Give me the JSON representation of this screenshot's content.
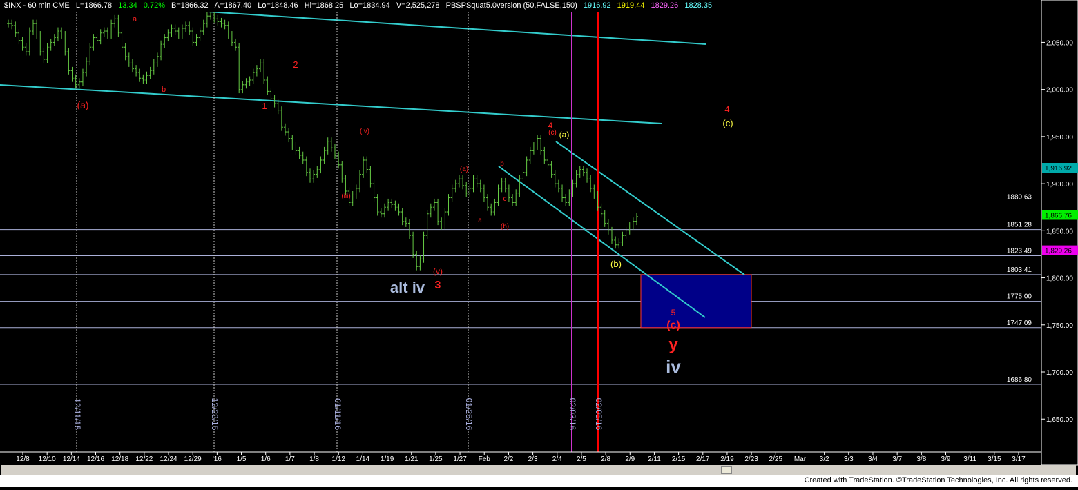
{
  "header": {
    "symbol": "$INX - 60 min  CME",
    "last": "L=1866.78",
    "change": "13.34",
    "change_pct": "0.72%",
    "bid": "B=1866.32",
    "ask": "A=1867.40",
    "low_today": "Lo=1848.46",
    "high": "Hi=1868.25",
    "low": "Lo=1834.94",
    "volume": "V=2,525,278",
    "indicator": "PBSPSquat5.0version (50,FALSE,150)",
    "ind_v1": "1916.92",
    "ind_v2": "1919.44",
    "ind_v3": "1829.26",
    "ind_v4": "1828.35"
  },
  "footer": {
    "text": "Created with TradeStation. ©TradeStation Technologies, Inc. All rights reserved."
  },
  "colors": {
    "background": "#000000",
    "bars": "#66cc44",
    "channel": "#33cccc",
    "red_label": "#ff2222",
    "yellow_label": "#ffff44",
    "blue_label": "#aabbdd",
    "target_box": "#000088",
    "magenta_line": "#cc33cc"
  },
  "chart_data": {
    "type": "ohlc",
    "ylim": [
      1615,
      2095
    ],
    "y_ticks": [
      "1,650.00",
      "1,700.00",
      "1,750.00",
      "1,800.00",
      "1,850.00",
      "1,900.00",
      "1,950.00",
      "2,000.00",
      "2,050.00"
    ],
    "x_labels": [
      "12/8",
      "12/10",
      "12/14",
      "12/16",
      "12/18",
      "12/22",
      "12/24",
      "12/29",
      "'16",
      "1/5",
      "1/6",
      "1/7",
      "1/8",
      "1/12",
      "1/14",
      "1/19",
      "1/21",
      "1/25",
      "1/27",
      "Feb",
      "2/2",
      "2/3",
      "2/4",
      "2/5",
      "2/8",
      "2/9",
      "2/11",
      "2/15",
      "2/17",
      "2/19",
      "2/23",
      "2/25",
      "Mar",
      "3/2",
      "3/3",
      "3/4",
      "3/7",
      "3/8",
      "3/9",
      "3/11",
      "3/15",
      "3/17"
    ],
    "price_levels": [
      "1880.63",
      "1851.28",
      "1823.49",
      "1803.41",
      "1775.00",
      "1747.09",
      "1686.80"
    ],
    "price_tags": [
      {
        "value": "1,916.92",
        "color": "#00aaaa"
      },
      {
        "value": "1,866.76",
        "color": "#00ee00"
      },
      {
        "value": "1,829.26",
        "color": "#ee00ee"
      }
    ],
    "date_markers": [
      "12/11/15",
      "12/28/15",
      "01/11/16",
      "01/25/16",
      "02/03/16",
      "02/05/16"
    ],
    "wave_labels": {
      "red": [
        "(a)",
        "a",
        "b",
        "1",
        "2",
        "(iii)",
        "(iv)",
        "(v)",
        "3",
        "(a)",
        "a",
        "b",
        "c",
        "(b)",
        "4",
        "(c)",
        "5",
        "(c)",
        "y",
        "4"
      ],
      "yellow": [
        "(a)",
        "(b)",
        "(c)"
      ],
      "blue": [
        "alt iv",
        "iv"
      ]
    },
    "target_zone": [
      1747.09,
      1803.41
    ],
    "series": [
      {
        "values": [
          2070,
          2068,
          2060,
          2052,
          2045,
          2040,
          2062,
          2070,
          2058,
          2040,
          2032,
          2045,
          2050,
          2055,
          2062,
          2058,
          2040,
          2020,
          2012,
          2005,
          2008,
          2018,
          2030,
          2045,
          2055,
          2052,
          2060,
          2062,
          2058,
          2070,
          2075,
          2060,
          2045,
          2035,
          2028,
          2022,
          2018,
          2012,
          2010,
          2015,
          2020,
          2028,
          2035,
          2048,
          2055,
          2060,
          2065,
          2062,
          2058,
          2065,
          2068,
          2062,
          2050,
          2055,
          2062,
          2070,
          2078,
          2080,
          2075,
          2072,
          2070,
          2068,
          2058,
          2050,
          2045,
          2000,
          2005,
          2008,
          2010,
          2018,
          2022,
          2028,
          2010,
          1998,
          1990,
          1985,
          1978,
          1960,
          1955,
          1948,
          1940,
          1935,
          1930,
          1925,
          1912,
          1905,
          1910,
          1915,
          1925,
          1935,
          1945,
          1938,
          1930,
          1920,
          1905,
          1892,
          1880,
          1888,
          1895,
          1910,
          1925,
          1915,
          1900,
          1885,
          1870,
          1868,
          1875,
          1880,
          1878,
          1875,
          1870,
          1860,
          1858,
          1845,
          1825,
          1812,
          1820,
          1845,
          1868,
          1875,
          1880,
          1860,
          1855,
          1870,
          1885,
          1895,
          1900,
          1905,
          1898,
          1890,
          1895,
          1905,
          1900,
          1895,
          1885,
          1875,
          1870,
          1880,
          1895,
          1902,
          1895,
          1885,
          1880,
          1890,
          1905,
          1912,
          1925,
          1935,
          1940,
          1948,
          1935,
          1925,
          1920,
          1910,
          1900,
          1895,
          1885,
          1880,
          1890,
          1900,
          1910,
          1915,
          1912,
          1905,
          1895,
          1888,
          1875,
          1868,
          1858,
          1850,
          1840,
          1835,
          1838,
          1845,
          1850,
          1855,
          1860,
          1865
        ]
      }
    ]
  }
}
